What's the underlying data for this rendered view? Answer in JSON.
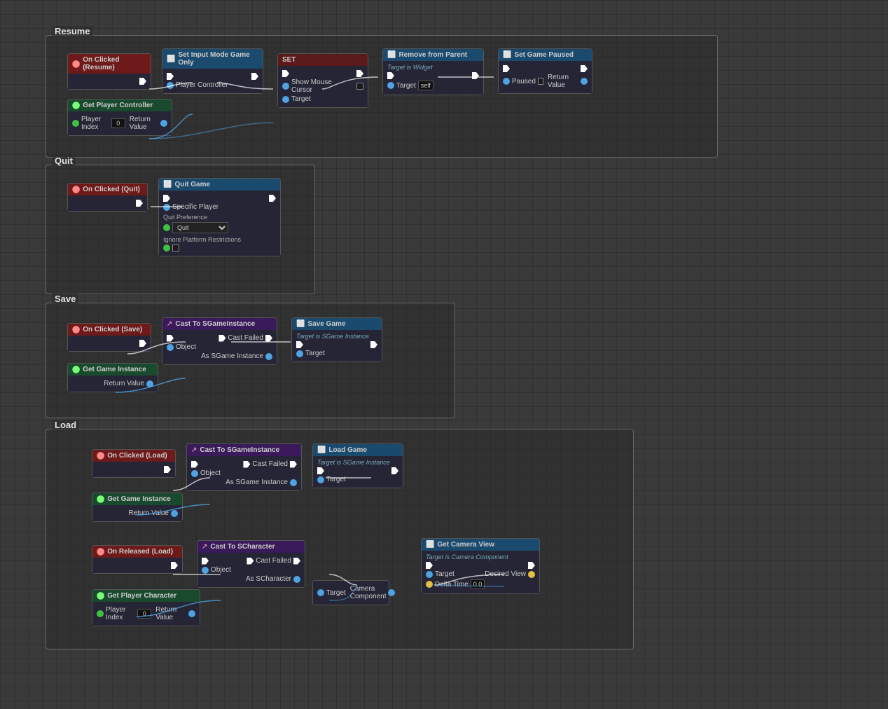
{
  "sections": {
    "resume": {
      "title": "Resume",
      "nodes": {
        "on_clicked_resume": {
          "label": "On Clicked (Resume)"
        },
        "set_input_mode": {
          "label": "Set Input Mode Game Only"
        },
        "set": {
          "label": "SET"
        },
        "remove_from_parent": {
          "label": "Remove from Parent",
          "subtitle": "Target is Widget"
        },
        "set_game_paused": {
          "label": "Set Game Paused"
        },
        "get_player_controller": {
          "label": "Get Player Controller",
          "pin_label": "Player Index",
          "pin_value": "0",
          "return": "Return Value"
        }
      }
    },
    "quit": {
      "title": "Quit",
      "nodes": {
        "on_clicked_quit": {
          "label": "On Clicked (Quit)"
        },
        "quit_game": {
          "label": "Quit Game",
          "specific_player": "Specific Player",
          "quit_preference_label": "Quit Preference",
          "quit_preference_value": "Quit",
          "ignore_platform": "Ignore Platform Restrictions"
        }
      }
    },
    "save": {
      "title": "Save",
      "nodes": {
        "on_clicked_save": {
          "label": "On Clicked (Save)"
        },
        "cast_to_sgame": {
          "label": "Cast To SGameInstance",
          "object": "Object",
          "cast_failed": "Cast Failed",
          "as_sgame": "As SGame Instance"
        },
        "save_game": {
          "label": "Save Game",
          "subtitle": "Target is SGame Instance",
          "target": "Target"
        },
        "get_game_instance": {
          "label": "Get Game Instance",
          "return": "Return Value"
        }
      }
    },
    "load": {
      "title": "Load",
      "nodes": {
        "on_clicked_load": {
          "label": "On Clicked (Load)"
        },
        "cast_to_sgame2": {
          "label": "Cast To SGameInstance",
          "object": "Object",
          "cast_failed": "Cast Failed",
          "as_sgame": "As SGame Instance"
        },
        "load_game": {
          "label": "Load Game",
          "subtitle": "Target is SGame Instance",
          "target": "Target"
        },
        "get_game_instance2": {
          "label": "Get Game Instance",
          "return": "Return Value"
        },
        "on_released_load": {
          "label": "On Released (Load)"
        },
        "cast_to_scharacter": {
          "label": "Cast To SCharacter",
          "object": "Object",
          "cast_failed": "Cast Failed",
          "as_schar": "As SCharacter"
        },
        "get_camera_view": {
          "label": "Get Camera View",
          "subtitle": "Target is Camera Component",
          "target": "Target",
          "desired_view": "Desired View",
          "delta_time": "Delta Time",
          "delta_value": "0.0"
        },
        "get_player_character": {
          "label": "Get Player Character",
          "pin_label": "Player Index",
          "pin_value": "0",
          "return": "Return Value"
        },
        "camera_component": {
          "label": "Camera Component"
        }
      }
    }
  },
  "colors": {
    "exec_white": "#ffffff",
    "pin_blue": "#4fa3e0",
    "pin_yellow": "#e0c040",
    "pin_green": "#5ec05e",
    "header_blue": "#1a4a6e",
    "header_red": "#7a2020",
    "header_green": "#2a5a3a",
    "header_teal": "#1a5a5a",
    "node_bg": "#252535"
  }
}
